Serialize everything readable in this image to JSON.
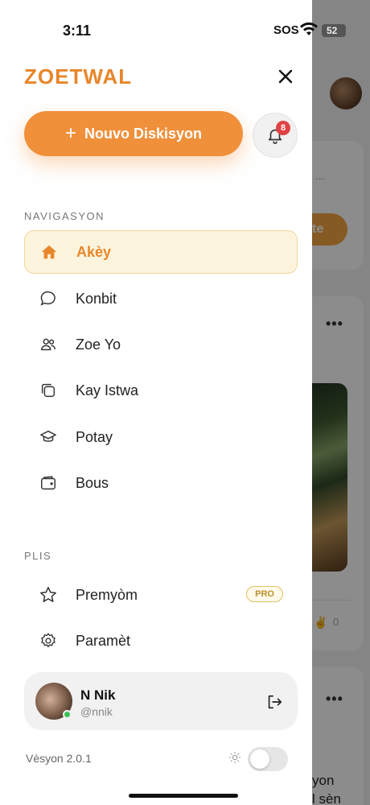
{
  "status_bar": {
    "time": "3:11",
    "carrier": "SOS",
    "battery": "52"
  },
  "background": {
    "button_fragment": "te",
    "ellipsis": "...",
    "menu_dots": "•••",
    "like_count": "0",
    "text_line_1": "yon",
    "text_line_2": "l sèn"
  },
  "drawer": {
    "brand": "ZOETWAL",
    "new_button_label": "Nouvo Diskisyon",
    "notification_count": "8",
    "nav_section": "NAVIGASYON",
    "nav_items": [
      {
        "label": "Akèy",
        "icon": "home-icon",
        "active": true
      },
      {
        "label": "Konbit",
        "icon": "chat-bubble-icon",
        "active": false
      },
      {
        "label": "Zoe Yo",
        "icon": "users-icon",
        "active": false
      },
      {
        "label": "Kay Istwa",
        "icon": "stories-icon",
        "active": false
      },
      {
        "label": "Potay",
        "icon": "graduation-cap-icon",
        "active": false
      },
      {
        "label": "Bous",
        "icon": "wallet-icon",
        "active": false
      }
    ],
    "more_section": "PLIS",
    "more_items": [
      {
        "label": "Premyòm",
        "icon": "star-icon",
        "badge": "PRO"
      },
      {
        "label": "Paramèt",
        "icon": "gear-icon"
      }
    ],
    "user": {
      "name": "N Nik",
      "handle": "@nnik"
    },
    "version": "Vèsyon 2.0.1",
    "accent_color": "#e8862b"
  }
}
